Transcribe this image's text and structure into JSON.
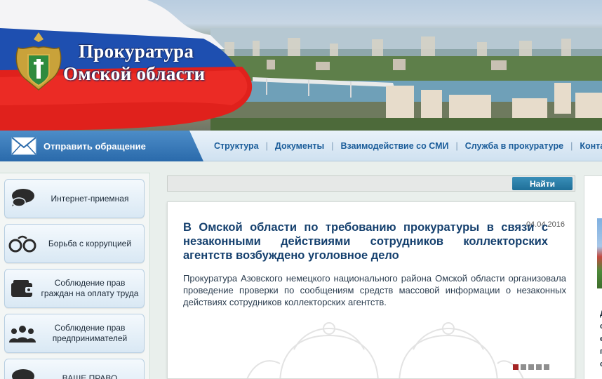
{
  "header": {
    "title_line1": "Прокуратура",
    "title_line2": "Омской области"
  },
  "navbar": {
    "appeal_label": "Отправить обращение",
    "menu": [
      "Структура",
      "Документы",
      "Взаимодействие со СМИ",
      "Служба в прокуратуре",
      "Контакты"
    ]
  },
  "sidebar": {
    "items": [
      {
        "label": "Интернет-приемная",
        "icon": "speech-bubbles-icon"
      },
      {
        "label": "Борьба с коррупцией",
        "icon": "handcuffs-icon"
      },
      {
        "label": "Соблюдение прав граждан на оплату труда",
        "icon": "wallet-icon"
      },
      {
        "label": "Соблюдение прав предпринимателей",
        "icon": "people-group-icon"
      },
      {
        "label": "ВАШЕ ПРАВО",
        "icon": "speech-bubble-icon"
      }
    ]
  },
  "search": {
    "placeholder": "",
    "button_label": "Найти"
  },
  "news": {
    "date": "04.04.2016",
    "headline": "В Омской области по требованию прокуратуры в связи с незаконными действиями сотрудников коллекторских агентств возбуждено уголовное дело",
    "body": "Прокуратура Азовского немецкого национального района Омской области организовала проведение проверки по сообщениям средств массовой информации о незаконных действиях сотрудников коллекторских агентств.",
    "slides_total": 5,
    "slide_active": 1
  },
  "right_panel": {
    "fragments": [
      "Д",
      "с",
      "е",
      "п",
      "с"
    ]
  },
  "colors": {
    "brand_blue": "#1b5d9a",
    "headline_blue": "#15406e",
    "search_button": "#1f6f98",
    "active_dot": "#a52525"
  }
}
